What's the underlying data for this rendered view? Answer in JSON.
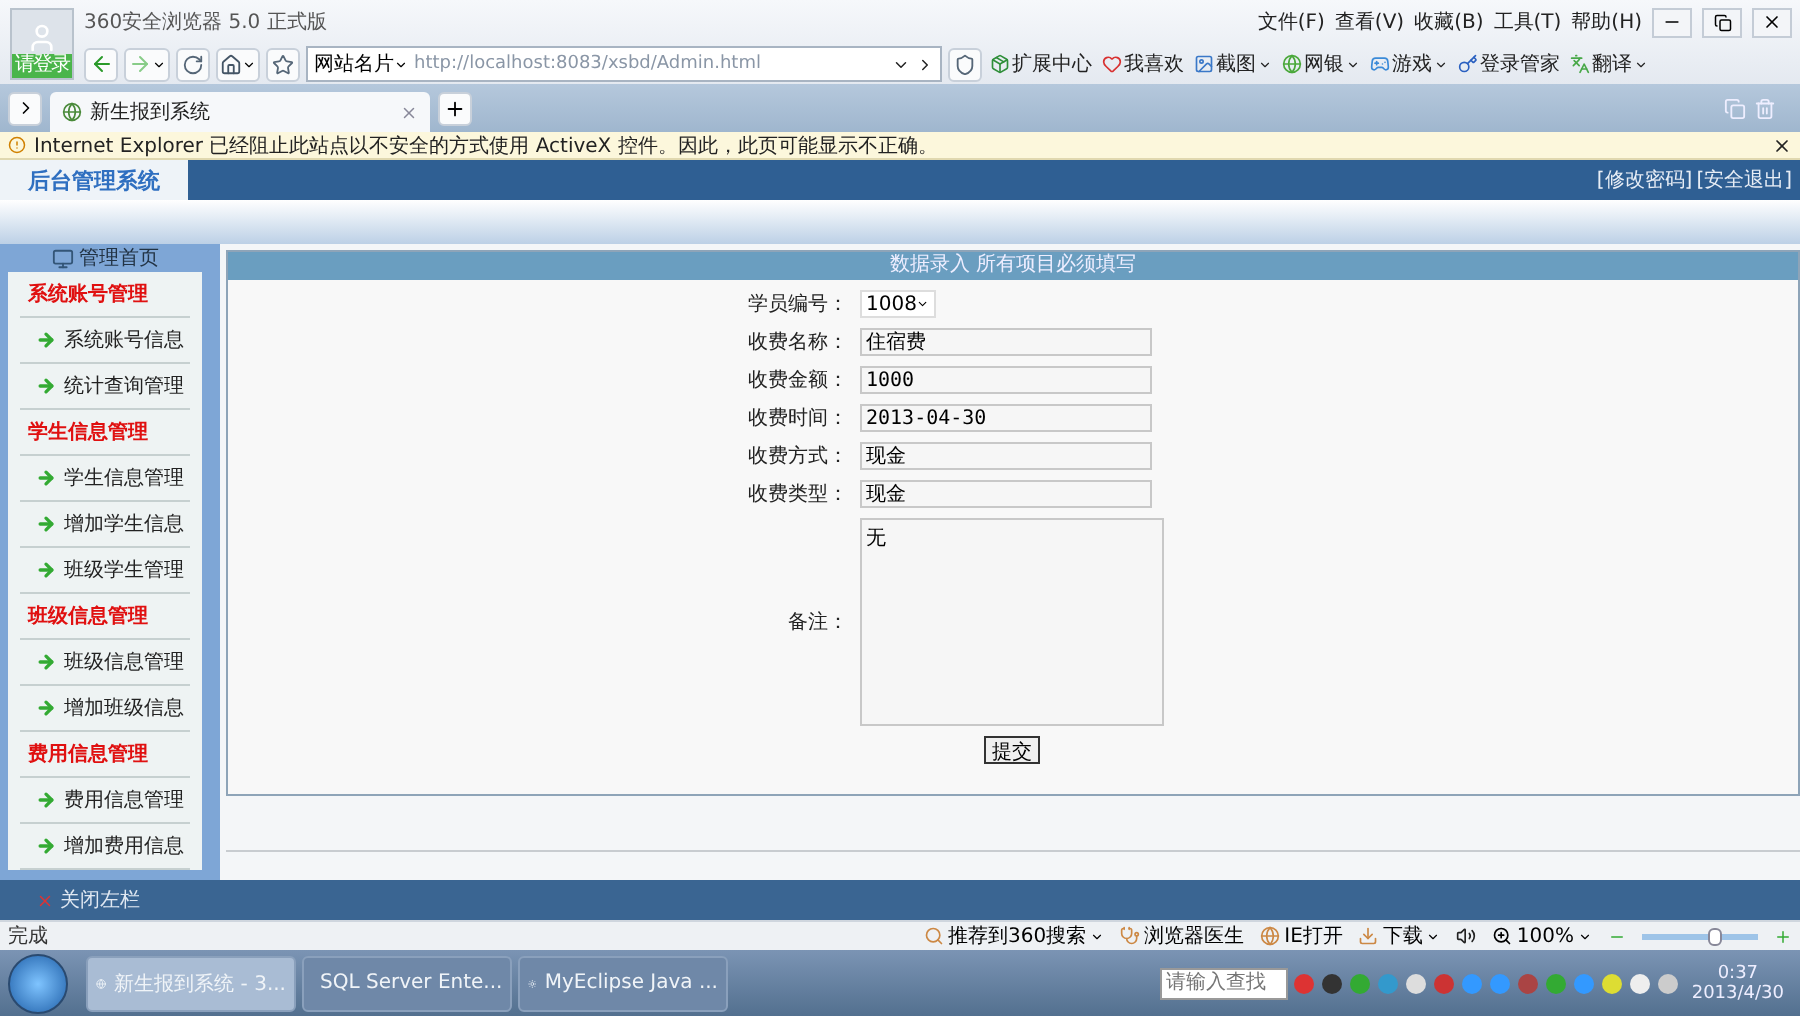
{
  "browser": {
    "title": "360安全浏览器 5.0 正式版",
    "login_label": "请登录",
    "menu": [
      "文件(F)",
      "查看(V)",
      "收藏(B)",
      "工具(T)",
      "帮助(H)"
    ],
    "site_card": "网站名片",
    "url": "http://localhost:8083/xsbd/Admin.html",
    "tools": [
      {
        "label": "扩展中心",
        "dropdown": false,
        "color": "#2f8f3a"
      },
      {
        "label": "我喜欢",
        "dropdown": false,
        "color": "#d83030"
      },
      {
        "label": "截图",
        "dropdown": true,
        "color": "#3a78c8"
      },
      {
        "label": "网银",
        "dropdown": true,
        "color": "#4aa83a"
      },
      {
        "label": "游戏",
        "dropdown": true,
        "color": "#3a8ad8"
      },
      {
        "label": "登录管家",
        "dropdown": false,
        "color": "#2a60c0"
      },
      {
        "label": "翻译",
        "dropdown": true,
        "color": "#48a848"
      }
    ],
    "tabs": [
      {
        "label": "新生报到系统",
        "selected": true
      }
    ],
    "infobar": "Internet Explorer 已经阻止此站点以不安全的方式使用 ActiveX 控件。因此，此页可能显示不正确。"
  },
  "page": {
    "header": {
      "title": "后台管理系统",
      "links": [
        "[修改密码]",
        "[安全退出]"
      ]
    },
    "sidebar": {
      "home": "管理首页",
      "groups": [
        {
          "title": "系统账号管理",
          "items": [
            "系统账号信息",
            "统计查询管理"
          ]
        },
        {
          "title": "学生信息管理",
          "items": [
            "学生信息管理",
            "增加学生信息",
            "班级学生管理"
          ]
        },
        {
          "title": "班级信息管理",
          "items": [
            "班级信息管理",
            "增加班级信息"
          ]
        },
        {
          "title": "费用信息管理",
          "items": [
            "费用信息管理",
            "增加费用信息"
          ]
        }
      ]
    },
    "form": {
      "title": "数据录入 所有项目必须填写",
      "fields": [
        {
          "label": "学员编号：",
          "kind": "select",
          "value": "1008"
        },
        {
          "label": "收费名称：",
          "kind": "text",
          "value": "住宿费"
        },
        {
          "label": "收费金额：",
          "kind": "text",
          "value": "1000"
        },
        {
          "label": "收费时间：",
          "kind": "text",
          "value": "2013-04-30"
        },
        {
          "label": "收费方式：",
          "kind": "text",
          "value": "现金"
        },
        {
          "label": "收费类型：",
          "kind": "text",
          "value": "现金"
        },
        {
          "label": "备注：",
          "kind": "textarea",
          "value": "无"
        }
      ],
      "submit": "提交"
    },
    "footer": "关闭左栏"
  },
  "status_bar": {
    "text": "完成",
    "items": [
      {
        "label": "推荐到360搜索",
        "dropdown": true
      },
      {
        "label": "浏览器医生",
        "dropdown": false
      },
      {
        "label": "IE打开",
        "dropdown": false
      },
      {
        "label": "下载",
        "dropdown": true
      }
    ],
    "zoom": "100%",
    "zoom_slider": {
      "level": 0.62
    }
  },
  "taskbar": {
    "tasks": [
      {
        "label": "新生报到系统 - 3...",
        "selected": true
      },
      {
        "label": "SQL Server Ente...",
        "selected": false
      },
      {
        "label": "MyEclipse Java ...",
        "selected": false
      }
    ],
    "ime_placeholder": "请输入查找",
    "time": "0:37",
    "date": "2013/4/30"
  }
}
